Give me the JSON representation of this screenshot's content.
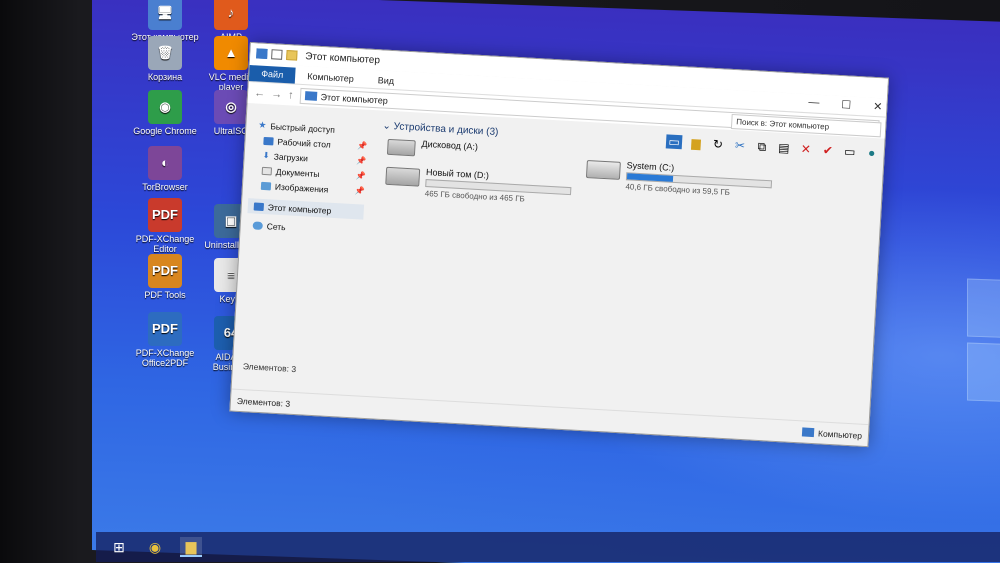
{
  "desktop_icons": [
    {
      "label": "Этот компьютер",
      "glyph": "🖥",
      "color": "#4a7fd0"
    },
    {
      "label": "AIMP",
      "glyph": "♪",
      "color": "#e05a1c"
    },
    {
      "label": "Корзина",
      "glyph": "🗑",
      "color": "#9aa7b8"
    },
    {
      "label": "VLC media player",
      "glyph": "▲",
      "color": "#f08a00"
    },
    {
      "label": "Google Chrome",
      "glyph": "◉",
      "color": "#2e9d4a"
    },
    {
      "label": "UltraISO",
      "glyph": "◎",
      "color": "#6b4bb5"
    },
    {
      "label": "TorBrowser",
      "glyph": "◐",
      "color": "#7d4698"
    },
    {
      "label": "PDF-XChange Editor",
      "glyph": "PDF",
      "color": "#c93a2c"
    },
    {
      "label": "Uninstall Tool",
      "glyph": "▣",
      "color": "#3c6a9a"
    },
    {
      "label": "PDF Tools",
      "glyph": "PDF",
      "color": "#d8861f"
    },
    {
      "label": "KeyIn",
      "glyph": "≡",
      "color": "#e9e9e9"
    },
    {
      "label": "PDF-XChange Office2PDF",
      "glyph": "PDF",
      "color": "#2d6cc0"
    },
    {
      "label": "AIDA64 Business",
      "glyph": "64",
      "color": "#1d5fb0"
    }
  ],
  "window": {
    "title": "Этот компьютер",
    "tabs": [
      "Файл",
      "Компьютер",
      "Вид"
    ],
    "address": "Этот компьютер",
    "search_placeholder": "Поиск в: Этот компьютер",
    "controls": {
      "minimize": "—",
      "maximize": "☐",
      "close": "✕"
    }
  },
  "nav": {
    "quick_access": "Быстрый доступ",
    "items": [
      "Рабочий стол",
      "Загрузки",
      "Документы",
      "Изображения"
    ],
    "this_pc": "Этот компьютер",
    "network": "Сеть"
  },
  "content": {
    "group_header": "Устройства и диски (3)",
    "drives": [
      {
        "name": "Дисковод (A:)",
        "has_bar": false,
        "free_text": ""
      },
      {
        "name": "Новый том (D:)",
        "has_bar": true,
        "used_fraction": 0.0,
        "free_text": "465 ГБ свободно из 465 ГБ"
      },
      {
        "name": "System (C:)",
        "has_bar": true,
        "used_fraction": 0.32,
        "free_text": "40,6 ГБ свободно из 59,5 ГБ"
      }
    ]
  },
  "status": {
    "items_text_pane": "Элементов: 3",
    "items_text": "Элементов: 3",
    "right_label": "Компьютер"
  }
}
